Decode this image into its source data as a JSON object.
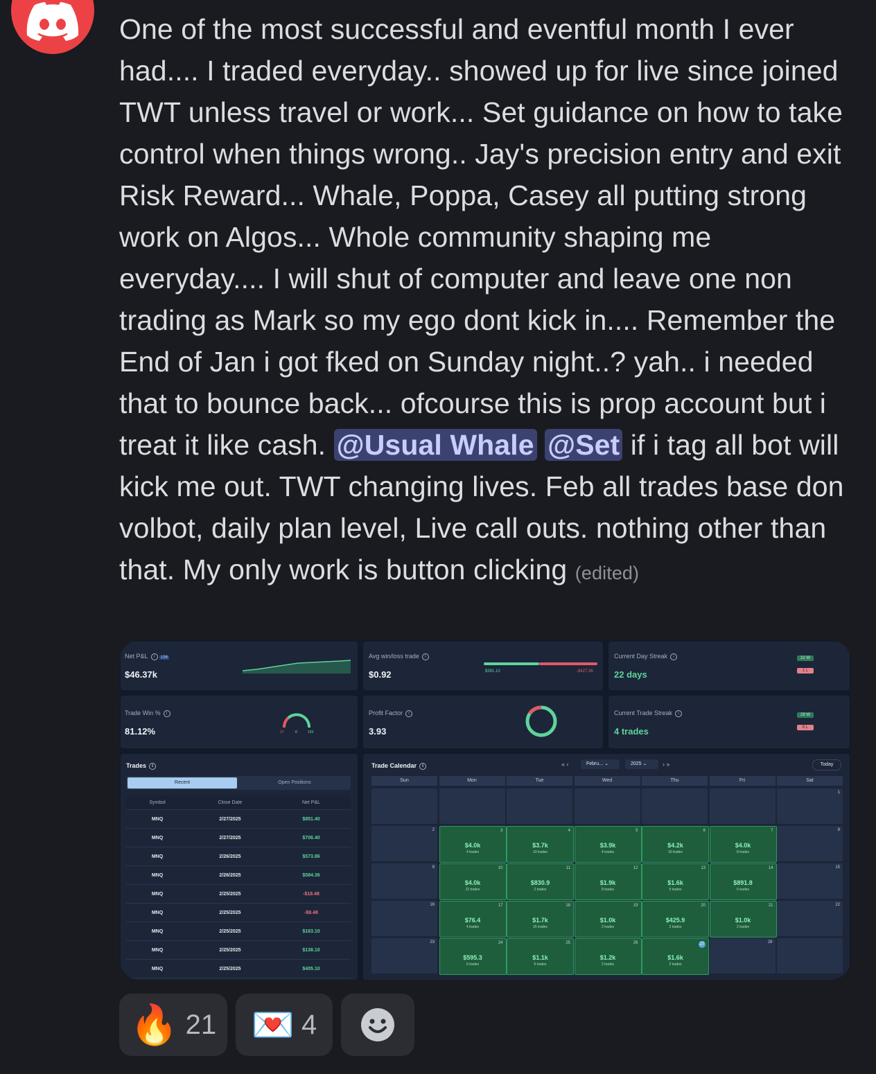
{
  "message": {
    "text": "One of the most successful and eventful month I ever had.... I traded everyday.. showed up  for live since joined TWT unless travel or work... Set guidance on how to take control when things wrong.. Jay's precision entry and exit Risk Reward... Whale, Poppa, Casey all putting strong work on Algos... Whole community shaping me everyday.... I will shut of computer and leave one non trading as Mark  so my ego dont kick in.... Remember the End of Jan i got fked on Sunday night..? yah.. i needed that to bounce back...  ofcourse this is prop account but i treat it like cash.",
    "mention1": "@Usual Whale",
    "mention2": "@Set",
    "text2": " if i tag all bot will kick me out. TWT changing lives. Feb all trades base don volbot, daily plan level, Live call outs. nothing other than that. My only work is button clicking",
    "edited": "(edited)"
  },
  "dashboard": {
    "net_pnl_label": "Net P&L",
    "net_pnl_count": "196",
    "net_pnl_value": "$46.37k",
    "avg_label": "Avg win/loss trade",
    "avg_value": "$0.92",
    "avg_win": "$391.10",
    "avg_loss": "-$427.36",
    "day_streak_label": "Current Day Streak",
    "day_streak_value": "22 days",
    "day_streak_w": "22 W",
    "day_streak_l": "1 L",
    "win_pct_label": "Trade Win %",
    "win_pct_value": "81.12%",
    "gauge_loss": "37",
    "gauge_be": "0",
    "gauge_win": "159",
    "pf_label": "Profit Factor",
    "pf_value": "3.93",
    "trade_streak_label": "Current Trade Streak",
    "trade_streak_value": "4 trades",
    "trade_streak_w": "29 W",
    "trade_streak_l": "6 L"
  },
  "trades": {
    "title": "Trades",
    "tab_recent": "Recent",
    "tab_open": "Open Positions",
    "headers": [
      "Symbol",
      "Close Date",
      "Net P&L"
    ],
    "rows": [
      [
        "MNQ",
        "2/27/2025",
        "$851.40"
      ],
      [
        "MNQ",
        "2/27/2025",
        "$706.40"
      ],
      [
        "MNQ",
        "2/26/2025",
        "$573.86"
      ],
      [
        "MNQ",
        "2/26/2025",
        "$584.36"
      ],
      [
        "MNQ",
        "2/25/2025",
        "-$18.48"
      ],
      [
        "MNQ",
        "2/25/2025",
        "-$9.48"
      ],
      [
        "MNQ",
        "2/25/2025",
        "$163.10"
      ],
      [
        "MNQ",
        "2/25/2025",
        "$138.10"
      ],
      [
        "MNQ",
        "2/25/2025",
        "$405.10"
      ]
    ]
  },
  "calendar": {
    "title": "Trade Calendar",
    "month": "Febru...",
    "year": "2025",
    "today": "Today",
    "days": [
      "Sun",
      "Mon",
      "Tue",
      "Wed",
      "Thu",
      "Fri",
      "Sat"
    ],
    "cells": [
      [
        "",
        "",
        "",
        "",
        "",
        "",
        "1"
      ],
      [
        "2",
        "3|$4.0k|4 trades",
        "4|$3.7k|10 trades",
        "5|$3.9k|4 trades",
        "6|$4.2k|16 trades",
        "7|$4.0k|8 trades",
        "8"
      ],
      [
        "9",
        "10|$4.0k|22 trades",
        "11|$830.9|2 trades",
        "12|$1.9k|8 trades",
        "13|$1.6k|9 trades",
        "14|$891.8|6 trades",
        "15"
      ],
      [
        "16",
        "17|$76.4|4 trades",
        "18|$1.7k|25 trades",
        "19|$1.0k|2 trades",
        "20|$425.9|2 trades",
        "21|$1.0k|2 trades",
        "22"
      ],
      [
        "23",
        "24|$595.3|6 trades",
        "25|$1.1k|6 trades",
        "26|$1.2k|2 trades",
        "27|$1.6k|2 trades",
        "28",
        ""
      ]
    ]
  },
  "reactions": [
    {
      "emoji": "🔥",
      "count": "21"
    },
    {
      "emoji": "💌",
      "count": "4"
    }
  ]
}
